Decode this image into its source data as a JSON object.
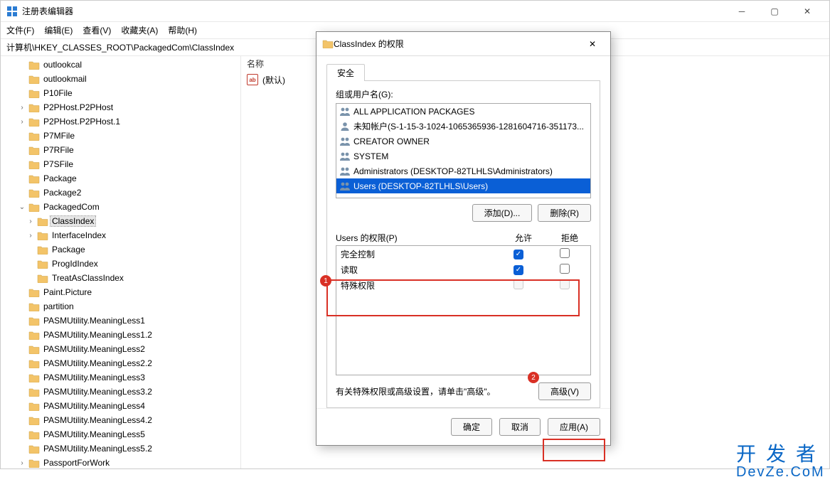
{
  "window": {
    "title": "注册表编辑器",
    "menus": [
      "文件(F)",
      "编辑(E)",
      "查看(V)",
      "收藏夹(A)",
      "帮助(H)"
    ],
    "address": "计算机\\HKEY_CLASSES_ROOT\\PackagedCom\\ClassIndex"
  },
  "tree": [
    {
      "indent": 2,
      "exp": "",
      "label": "outlookcal"
    },
    {
      "indent": 2,
      "exp": "",
      "label": "outlookmail"
    },
    {
      "indent": 2,
      "exp": "",
      "label": "P10File"
    },
    {
      "indent": 2,
      "exp": ">",
      "label": "P2PHost.P2PHost"
    },
    {
      "indent": 2,
      "exp": ">",
      "label": "P2PHost.P2PHost.1"
    },
    {
      "indent": 2,
      "exp": "",
      "label": "P7MFile"
    },
    {
      "indent": 2,
      "exp": "",
      "label": "P7RFile"
    },
    {
      "indent": 2,
      "exp": "",
      "label": "P7SFile"
    },
    {
      "indent": 2,
      "exp": "",
      "label": "Package"
    },
    {
      "indent": 2,
      "exp": "",
      "label": "Package2"
    },
    {
      "indent": 2,
      "exp": "v",
      "label": "PackagedCom"
    },
    {
      "indent": 3,
      "exp": ">",
      "label": "ClassIndex",
      "selected": true
    },
    {
      "indent": 3,
      "exp": ">",
      "label": "InterfaceIndex"
    },
    {
      "indent": 3,
      "exp": "",
      "label": "Package"
    },
    {
      "indent": 3,
      "exp": "",
      "label": "ProgIdIndex"
    },
    {
      "indent": 3,
      "exp": "",
      "label": "TreatAsClassIndex"
    },
    {
      "indent": 2,
      "exp": "",
      "label": "Paint.Picture"
    },
    {
      "indent": 2,
      "exp": "",
      "label": "partition"
    },
    {
      "indent": 2,
      "exp": "",
      "label": "PASMUtility.MeaningLess1"
    },
    {
      "indent": 2,
      "exp": "",
      "label": "PASMUtility.MeaningLess1.2"
    },
    {
      "indent": 2,
      "exp": "",
      "label": "PASMUtility.MeaningLess2"
    },
    {
      "indent": 2,
      "exp": "",
      "label": "PASMUtility.MeaningLess2.2"
    },
    {
      "indent": 2,
      "exp": "",
      "label": "PASMUtility.MeaningLess3"
    },
    {
      "indent": 2,
      "exp": "",
      "label": "PASMUtility.MeaningLess3.2"
    },
    {
      "indent": 2,
      "exp": "",
      "label": "PASMUtility.MeaningLess4"
    },
    {
      "indent": 2,
      "exp": "",
      "label": "PASMUtility.MeaningLess4.2"
    },
    {
      "indent": 2,
      "exp": "",
      "label": "PASMUtility.MeaningLess5"
    },
    {
      "indent": 2,
      "exp": "",
      "label": "PASMUtility.MeaningLess5.2"
    },
    {
      "indent": 2,
      "exp": ">",
      "label": "PassportForWork"
    }
  ],
  "values": {
    "header_name": "名称",
    "default_name": "(默认)"
  },
  "dialog": {
    "title": "ClassIndex 的权限",
    "tab": "安全",
    "group_label": "组或用户名(G):",
    "principals": [
      {
        "icon": "group",
        "name": "ALL APPLICATION PACKAGES"
      },
      {
        "icon": "user",
        "name": "未知帐户(S-1-15-3-1024-1065365936-1281604716-351173..."
      },
      {
        "icon": "pair",
        "name": "CREATOR OWNER"
      },
      {
        "icon": "pair",
        "name": "SYSTEM"
      },
      {
        "icon": "pair",
        "name": "Administrators (DESKTOP-82TLHLS\\Administrators)"
      },
      {
        "icon": "pair",
        "name": "Users (DESKTOP-82TLHLS\\Users)",
        "selected": true
      }
    ],
    "add_btn": "添加(D)...",
    "remove_btn": "删除(R)",
    "perm_label": "Users 的权限(P)",
    "col_allow": "允许",
    "col_deny": "拒绝",
    "perms": [
      {
        "name": "完全控制",
        "allow": true,
        "deny": false
      },
      {
        "name": "读取",
        "allow": true,
        "deny": false
      },
      {
        "name": "特殊权限",
        "allow": false,
        "deny": false,
        "disabled": true
      }
    ],
    "advice": "有关特殊权限或高级设置，请单击\"高级\"。",
    "adv_btn": "高级(V)",
    "ok": "确定",
    "cancel": "取消",
    "apply": "应用(A)"
  },
  "badges": {
    "one": "1",
    "two": "2"
  },
  "watermark": {
    "l1": "开发者",
    "l2": "DevZe.CoM"
  }
}
